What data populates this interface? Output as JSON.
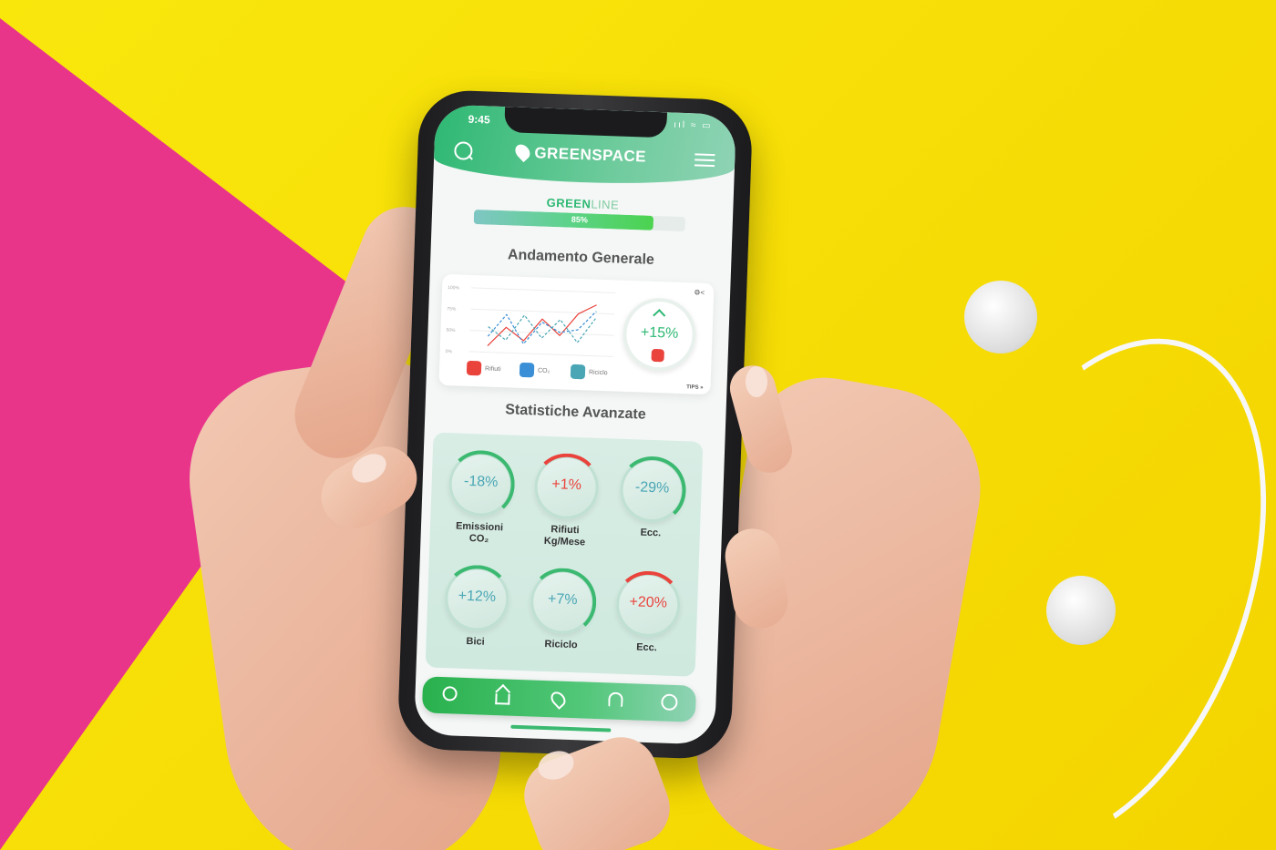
{
  "status": {
    "time": "9:45",
    "icons": "ııl ≈ ▭"
  },
  "header": {
    "brand": "GREENSPACE",
    "icons": [
      "search-icon",
      "leaf-icon",
      "menu-icon"
    ]
  },
  "greenline": {
    "title_strong": "GREEN",
    "title_light": "LINE",
    "progress": 0.85,
    "label": "85%"
  },
  "overview": {
    "title": "Andamento Generale",
    "gauge": {
      "value": "+15%"
    },
    "controls": "⚙<",
    "tips": "TIPS »",
    "legend": [
      {
        "label": "Rifiuti",
        "color": "#e9433c",
        "icon": "home-icon"
      },
      {
        "label": "CO₂",
        "color": "#3a8fd6",
        "icon": "send-icon"
      },
      {
        "label": "Riciclo",
        "color": "#4aa6b5",
        "icon": "leaf-icon"
      }
    ]
  },
  "chart_data": {
    "type": "line",
    "x": [
      0,
      1,
      2,
      3,
      4,
      5,
      6
    ],
    "yticks": [
      "100%",
      "75%",
      "50%",
      "0%"
    ],
    "ylim": [
      0,
      100
    ],
    "series": [
      {
        "color": "#e9433c",
        "values": [
          10,
          40,
          20,
          55,
          30,
          65,
          80
        ]
      },
      {
        "color": "#3a8fd6",
        "values": [
          25,
          60,
          15,
          50,
          35,
          40,
          70
        ]
      },
      {
        "color": "#4aa6b5",
        "values": [
          40,
          20,
          60,
          25,
          55,
          20,
          60
        ]
      }
    ]
  },
  "stats": {
    "title": "Statistiche Avanzate",
    "items": [
      {
        "value": "-18%",
        "label": "Emissioni",
        "label2": "CO₂",
        "color": "#4aa6b5",
        "arc": "#3bb970"
      },
      {
        "value": "+1%",
        "label": "Rifiuti",
        "label2": "Kg/Mese",
        "color": "#e9433c",
        "arc": "#e9433c"
      },
      {
        "value": "-29%",
        "label": "Ecc.",
        "label2": "",
        "color": "#4aa6b5",
        "arc": "#3bb970"
      },
      {
        "value": "+12%",
        "label": "Bici",
        "label2": "",
        "color": "#4aa6b5",
        "arc": "#3bb970"
      },
      {
        "value": "+7%",
        "label": "Riciclo",
        "label2": "",
        "color": "#4aa6b5",
        "arc": "#3bb970"
      },
      {
        "value": "+20%",
        "label": "Ecc.",
        "label2": "",
        "color": "#e9433c",
        "arc": "#e9433c"
      }
    ]
  },
  "tabbar": {
    "icons": [
      "search-icon",
      "home-icon",
      "leaf-icon",
      "bell-icon",
      "user-icon"
    ]
  }
}
